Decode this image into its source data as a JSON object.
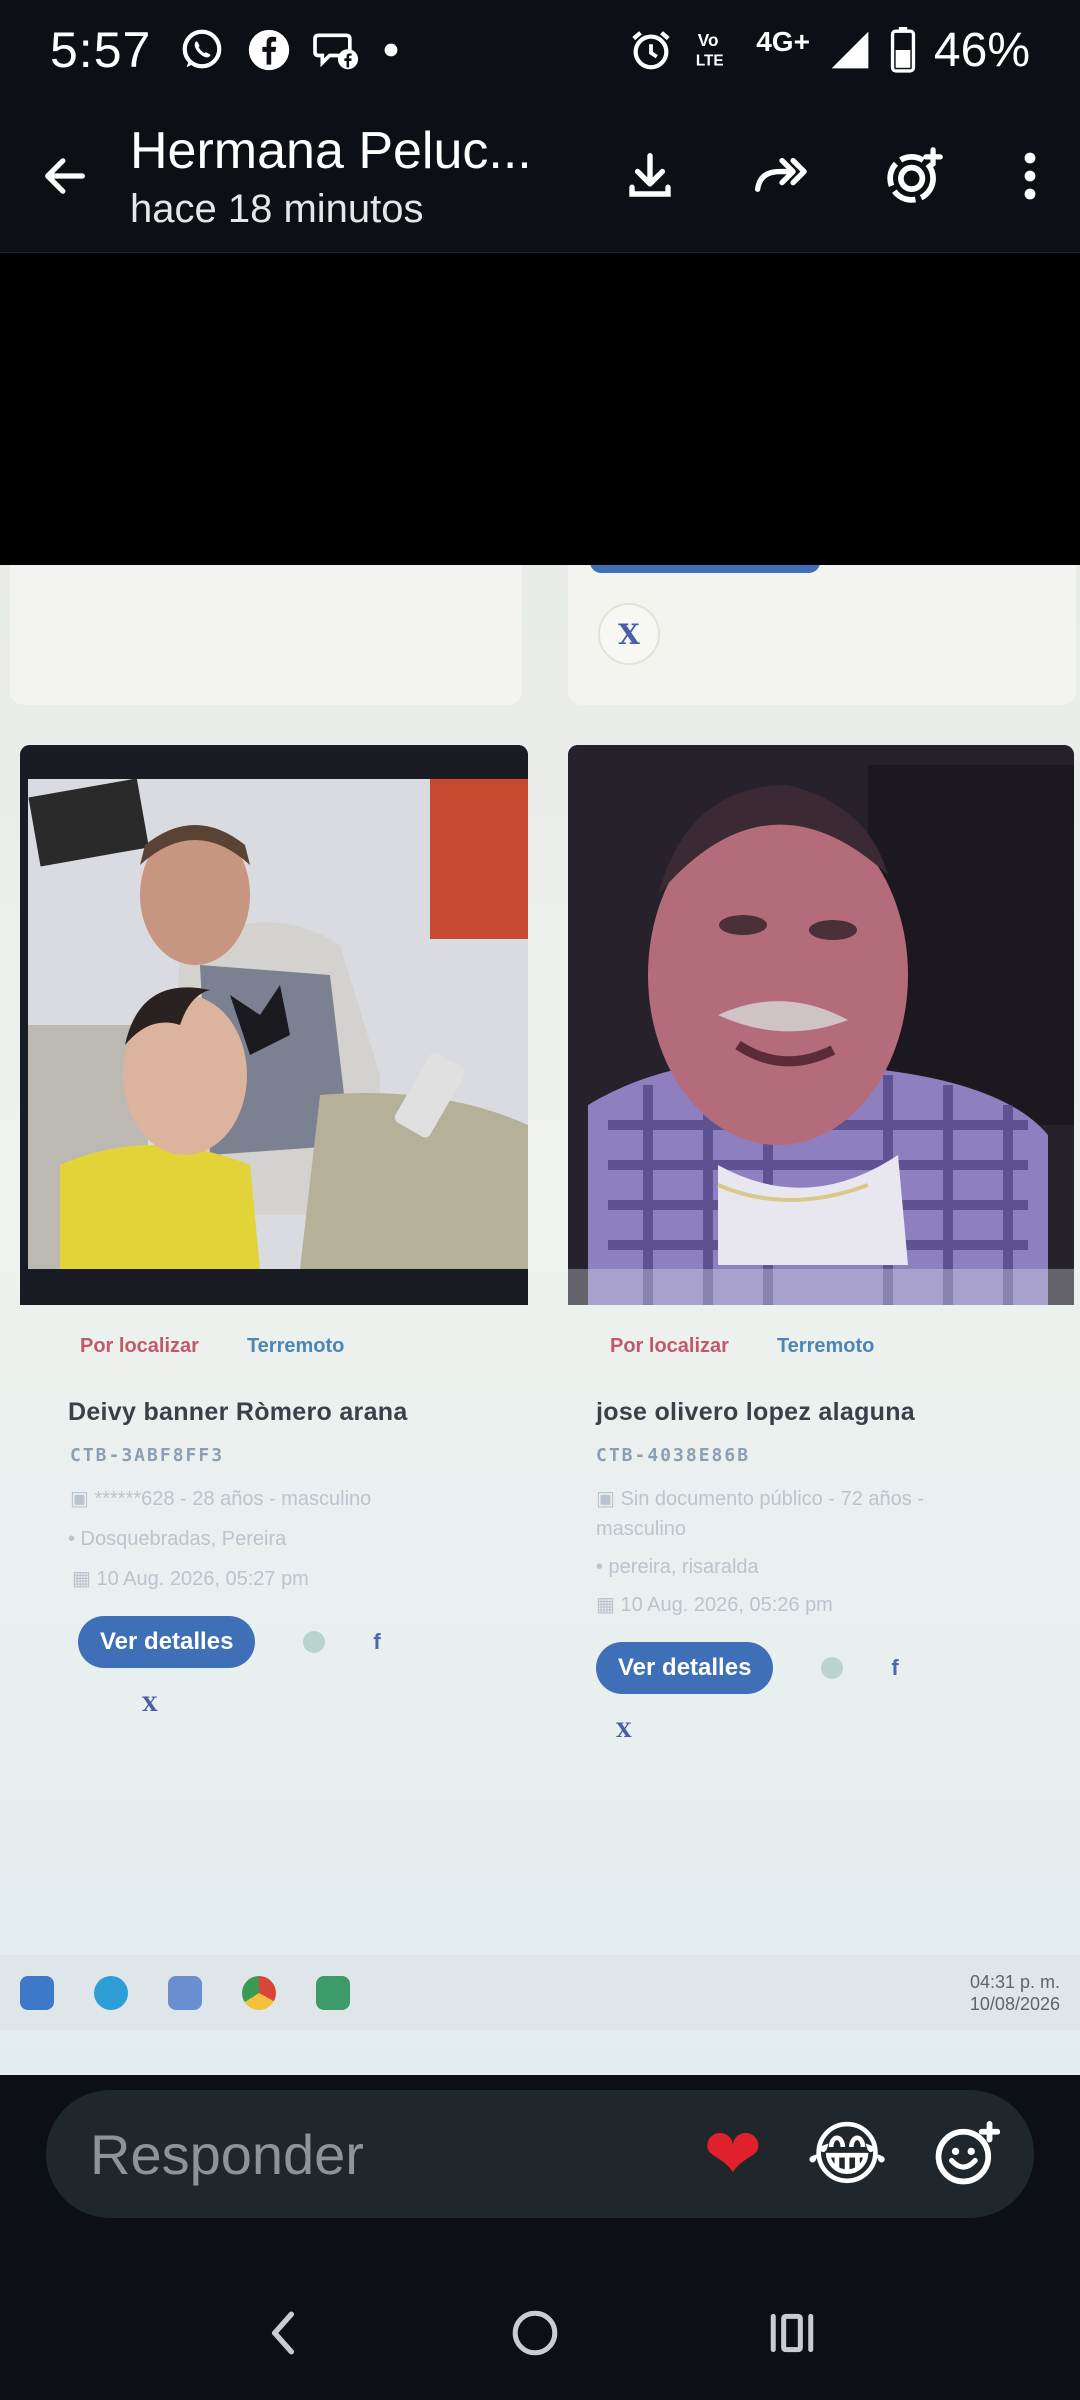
{
  "status_bar": {
    "time": "5:57",
    "network_label": "4G+",
    "volte_label": "Vo LTE",
    "battery": "46%"
  },
  "header": {
    "title": "Hermana Peluc...",
    "subtitle": "hace 18 minutos"
  },
  "photo": {
    "cards": [
      {
        "tag_status": "Por localizar",
        "tag_event": "Terremoto",
        "name": "Deivy banner Ròmero arana",
        "code": "CTB-3ABF8FF3",
        "doc_line": "▣ ******628 - 28 años - masculino",
        "location": "• Dosquebradas, Pereira",
        "date": "▦ 10 Aug. 2026, 05:27 pm",
        "button": "Ver detalles",
        "fb": "f",
        "x": "X"
      },
      {
        "tag_status": "Por localizar",
        "tag_event": "Terremoto",
        "name": "jose olivero lopez alaguna",
        "code": "CTB-4038E86B",
        "doc_line": "▣ Sin documento público - 72 años - masculino",
        "location": "• pereira, risaralda",
        "date": "▦ 10 Aug. 2026, 05:26 pm",
        "button": "Ver detalles",
        "fb": "f",
        "x": "X"
      }
    ],
    "top_x": "X",
    "taskbar_time": "04:31 p. m.",
    "taskbar_date": "10/08/2026"
  },
  "reply": {
    "placeholder": "Responder",
    "reaction_heart": "❤",
    "reaction_laugh": "😂"
  },
  "colors": {
    "bar_bg": "#0c1014",
    "reply_bg": "#1f272d",
    "accent_button": "#3f6fb6"
  }
}
